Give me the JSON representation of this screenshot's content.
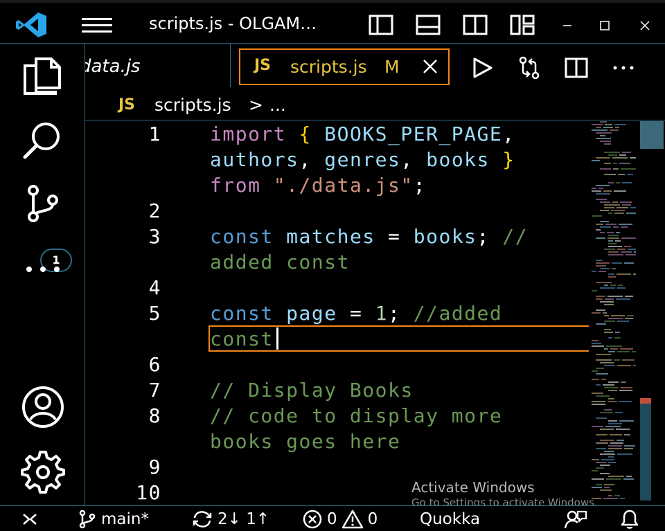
{
  "titlebar": {
    "title": "scripts.js - OLGAM…",
    "icons": [
      "vscode-logo-icon",
      "hamburger-menu-icon",
      "toggle-primary-sidebar-icon",
      "toggle-panel-icon",
      "toggle-secondary-sidebar-icon",
      "customize-layout-icon",
      "minimize-icon",
      "maximize-icon",
      "close-icon"
    ]
  },
  "activitybar": {
    "items": [
      "explorer-icon",
      "search-icon",
      "source-control-icon",
      "more-icon",
      "accounts-icon",
      "manage-gear-icon"
    ],
    "scm_badge": "1"
  },
  "tabs": {
    "previous_label": "data.js",
    "active": {
      "lang": "JS",
      "name": "scripts.js",
      "status": "M"
    },
    "actions": [
      "run-icon",
      "compare-changes-icon",
      "split-editor-icon",
      "more-actions-icon"
    ]
  },
  "breadcrumb": {
    "lang": "JS",
    "file": "scripts.js",
    "separator": ">",
    "more": "..."
  },
  "editor": {
    "line_numbers": [
      "1",
      "2",
      "3",
      "4",
      "5",
      "6",
      "7",
      "8",
      "9",
      "10"
    ],
    "line1a": {
      "kw": "import",
      "br1": "{",
      "id": "BOOKS_PER_PAGE",
      "pu": ","
    },
    "line1b": {
      "id1": "authors",
      "pu1": ",",
      "id2": "genres",
      "pu2": ",",
      "id3": "books",
      "br2": "}"
    },
    "line1c": {
      "kw": "from",
      "str": "\"./data.js\"",
      "pu": ";"
    },
    "line3a": {
      "kw": "const",
      "id": "matches",
      "op": "=",
      "id2": "books",
      "pu": ";",
      "cm": "//"
    },
    "line3b": {
      "cm": "added const"
    },
    "line5a": {
      "kw": "const",
      "id": "page",
      "op": "=",
      "num": "1",
      "pu": ";",
      "cm": "//added"
    },
    "line5b": {
      "cm": "const"
    },
    "line7": {
      "cm": "// Display Books"
    },
    "line8a": {
      "cm": "// code to display more"
    },
    "line8b": {
      "cm": "books goes here"
    }
  },
  "watermark": {
    "title": "Activate Windows",
    "subtitle": "Go to Settings to activate Windows."
  },
  "statusbar": {
    "remote_icon": "remote-icon",
    "branch": "main*",
    "sync": "2↓ 1↑",
    "errors": "0",
    "warnings": "0",
    "extension": "Quokka",
    "icons": [
      "git-branch-icon",
      "sync-icon",
      "error-icon",
      "warning-icon",
      "feedback-icon",
      "notifications-bell-icon"
    ]
  },
  "colors": {
    "border": "#2b6b88",
    "active_border": "#f38518",
    "js_yellow": "#e8c43e",
    "keyword_import": "#c586c0",
    "keyword_const": "#569cd6",
    "identifier": "#9cdcfe",
    "string": "#ce9178",
    "comment": "#6a9955"
  }
}
